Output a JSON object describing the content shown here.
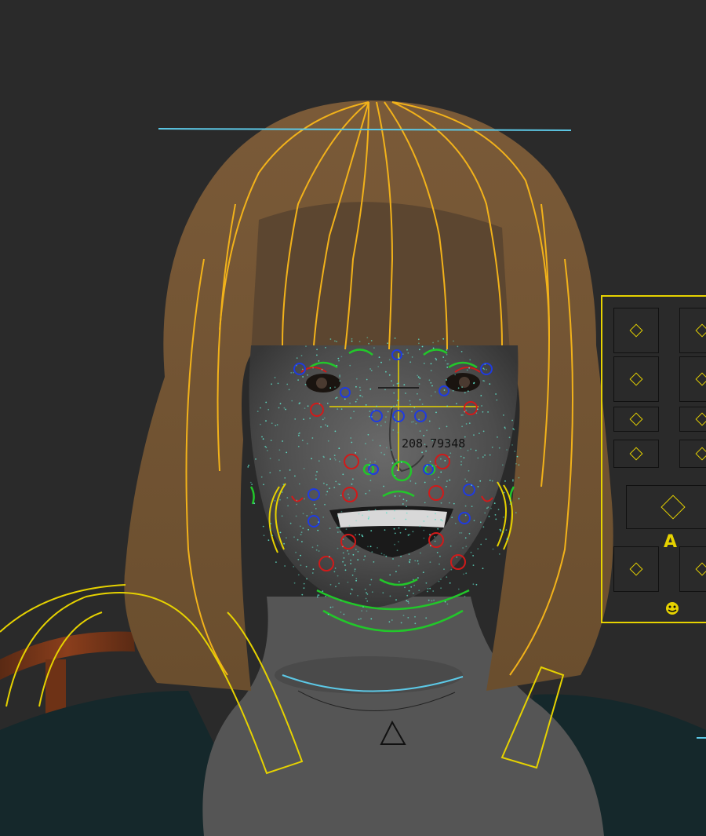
{
  "viewport": {
    "distance_readout": "208.79348"
  },
  "facial_panel": {
    "label_glyph": "A",
    "bottom_icon": "face-icon"
  },
  "colors": {
    "background": "#2a2a2a",
    "hair_guide": "#f2b21a",
    "control_yellow": "#e6d200",
    "control_green": "#22c72a",
    "control_red": "#d01a1a",
    "control_blue": "#1f3be0",
    "vertex_cyan": "#5fe0c8",
    "head_bound": "#5cc8e6"
  }
}
